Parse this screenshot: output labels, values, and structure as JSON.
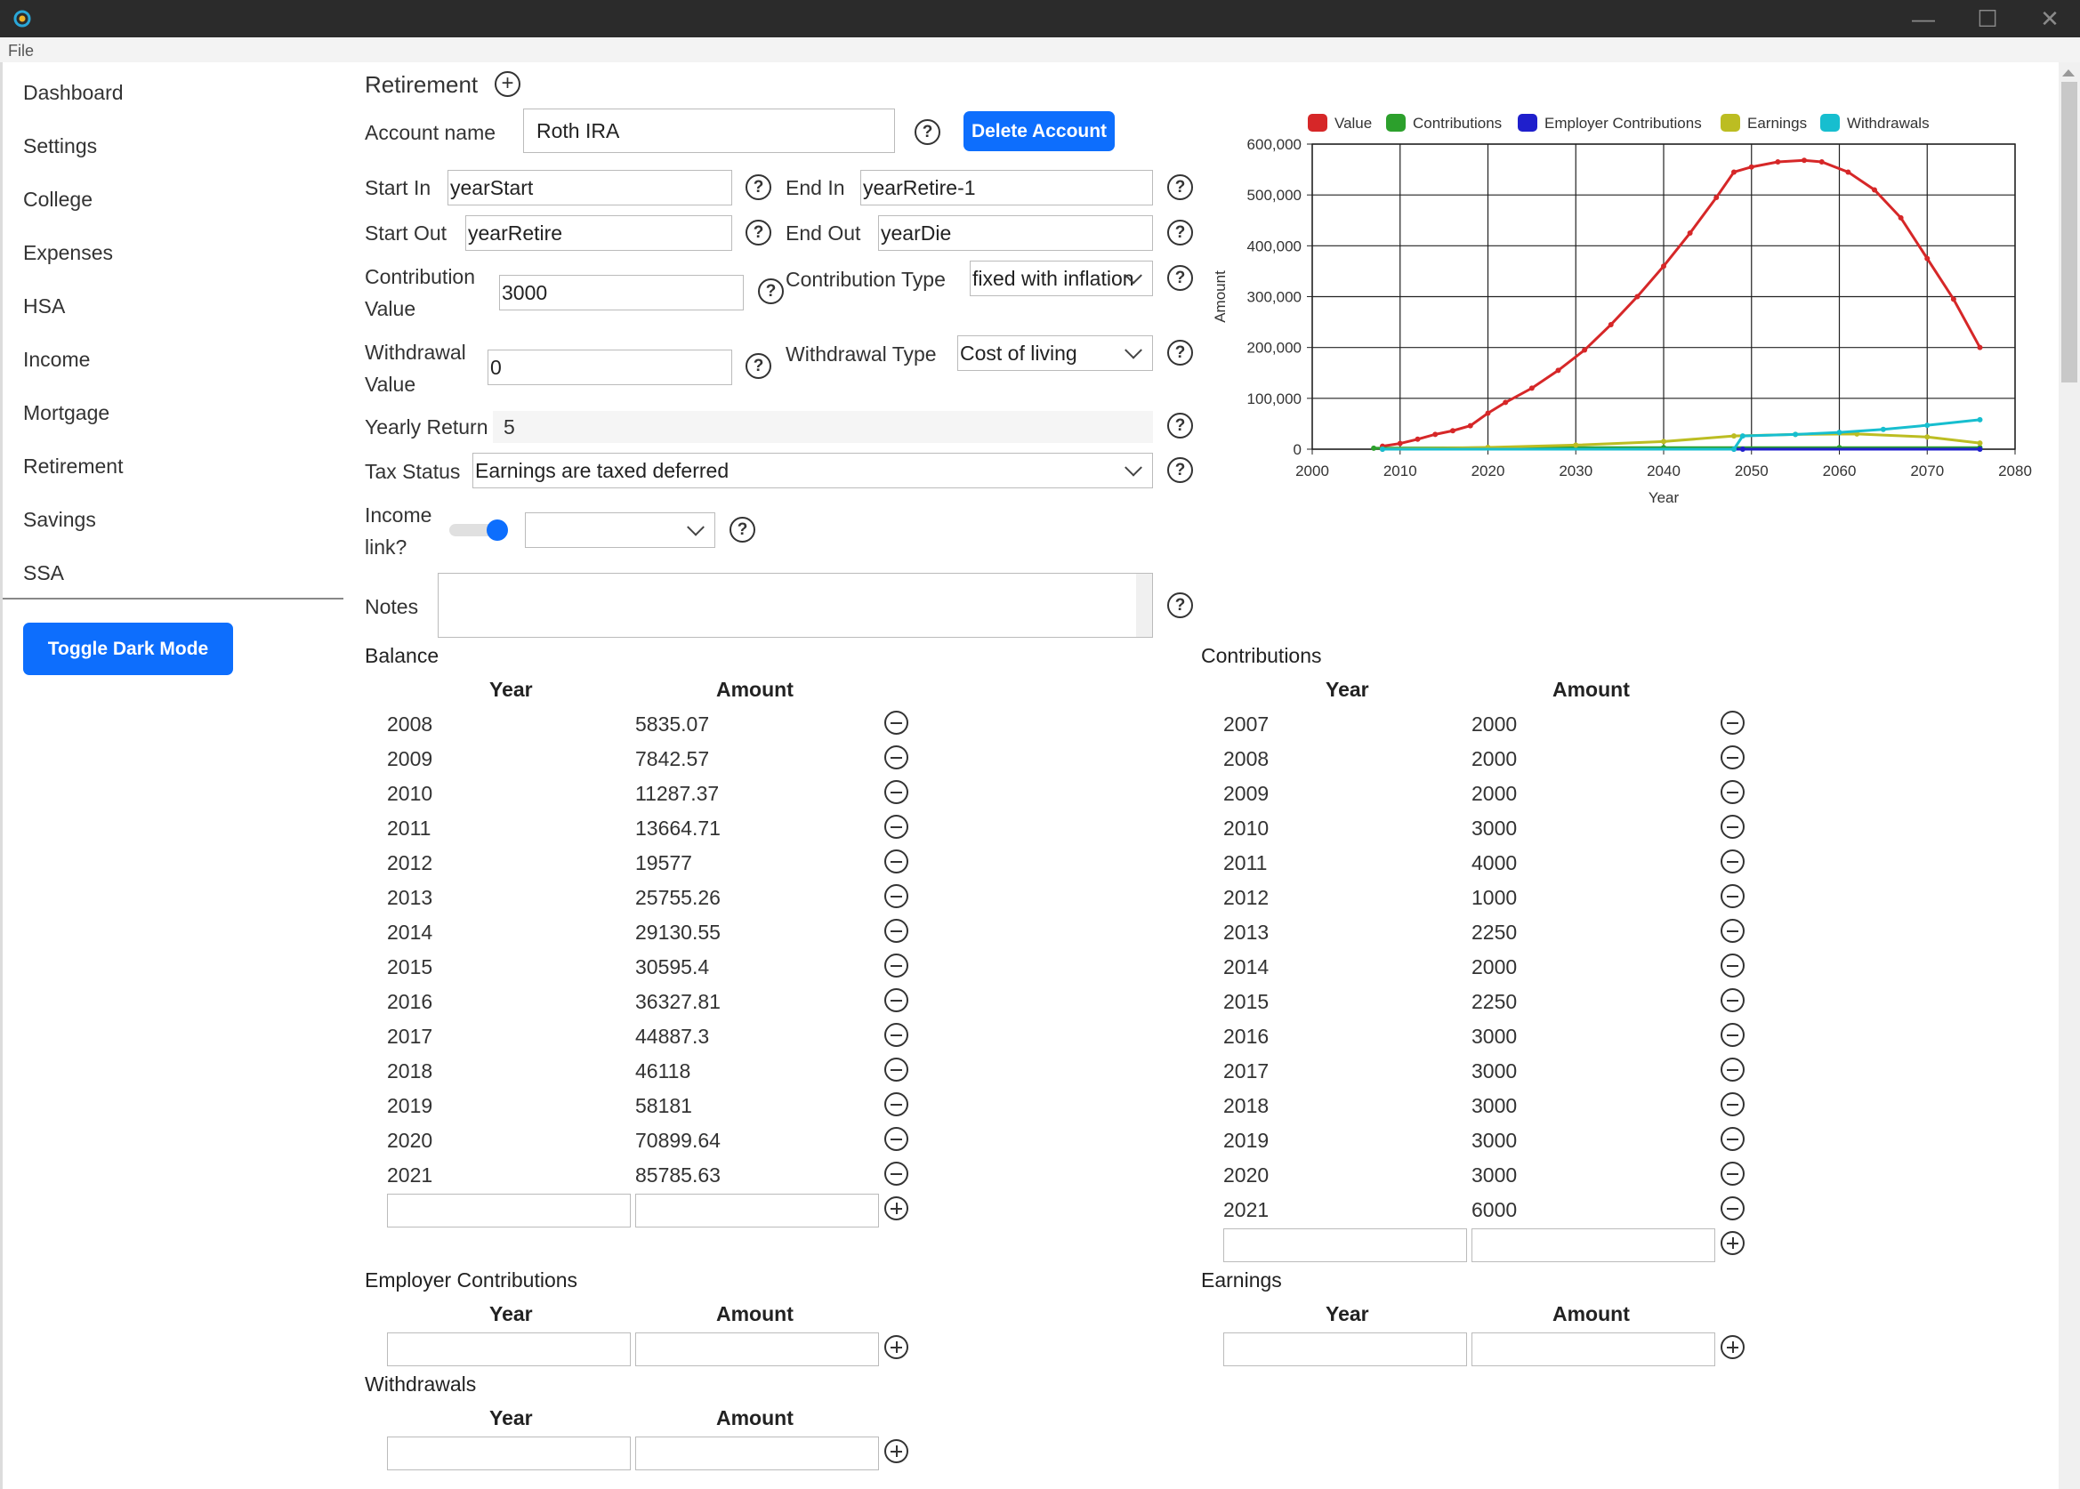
{
  "app": {
    "menu": {
      "file": "File"
    },
    "window_controls": {
      "minimize": "—",
      "maximize": "☐",
      "close": "✕"
    }
  },
  "sidebar": {
    "items": [
      {
        "label": "Dashboard"
      },
      {
        "label": "Settings"
      },
      {
        "label": "College"
      },
      {
        "label": "Expenses"
      },
      {
        "label": "HSA"
      },
      {
        "label": "Income"
      },
      {
        "label": "Mortgage"
      },
      {
        "label": "Retirement"
      },
      {
        "label": "Savings"
      },
      {
        "label": "SSA"
      }
    ],
    "toggle_dark_mode": "Toggle Dark Mode"
  },
  "form": {
    "title": "Retirement",
    "add_icon": "⊕",
    "account_name": {
      "label": "Account name",
      "value": "Roth IRA"
    },
    "delete_button": "Delete Account",
    "start_in": {
      "label": "Start In",
      "value": "yearStart"
    },
    "end_in": {
      "label": "End In",
      "value": "yearRetire-1"
    },
    "start_out": {
      "label": "Start Out",
      "value": "yearRetire"
    },
    "end_out": {
      "label": "End Out",
      "value": "yearDie"
    },
    "contribution_value": {
      "label_line1": "Contribution",
      "label_line2": "Value",
      "value": "3000"
    },
    "contribution_type": {
      "label": "Contribution Type",
      "value": "fixed with inflation"
    },
    "withdrawal_value": {
      "label_line1": "Withdrawal",
      "label_line2": "Value",
      "value": "0"
    },
    "withdrawal_type": {
      "label": "Withdrawal Type",
      "value": "Cost of living"
    },
    "yearly_return": {
      "label": "Yearly Return",
      "value": "5"
    },
    "tax_status": {
      "label": "Tax Status",
      "value": "Earnings are taxed deferred"
    },
    "income_link": {
      "label_line1": "Income",
      "label_line2": "link?",
      "value": "",
      "toggle_on": true
    },
    "notes": {
      "label": "Notes",
      "value": ""
    },
    "help_icon": "?"
  },
  "tables": {
    "col_year": "Year",
    "col_amount": "Amount",
    "balance": {
      "title": "Balance",
      "rows": [
        [
          "2008",
          "5835.07"
        ],
        [
          "2009",
          "7842.57"
        ],
        [
          "2010",
          "11287.37"
        ],
        [
          "2011",
          "13664.71"
        ],
        [
          "2012",
          "19577"
        ],
        [
          "2013",
          "25755.26"
        ],
        [
          "2014",
          "29130.55"
        ],
        [
          "2015",
          "30595.4"
        ],
        [
          "2016",
          "36327.81"
        ],
        [
          "2017",
          "44887.3"
        ],
        [
          "2018",
          "46118"
        ],
        [
          "2019",
          "58181"
        ],
        [
          "2020",
          "70899.64"
        ],
        [
          "2021",
          "85785.63"
        ]
      ]
    },
    "contributions": {
      "title": "Contributions",
      "rows": [
        [
          "2007",
          "2000"
        ],
        [
          "2008",
          "2000"
        ],
        [
          "2009",
          "2000"
        ],
        [
          "2010",
          "3000"
        ],
        [
          "2011",
          "4000"
        ],
        [
          "2012",
          "1000"
        ],
        [
          "2013",
          "2250"
        ],
        [
          "2014",
          "2000"
        ],
        [
          "2015",
          "2250"
        ],
        [
          "2016",
          "3000"
        ],
        [
          "2017",
          "3000"
        ],
        [
          "2018",
          "3000"
        ],
        [
          "2019",
          "3000"
        ],
        [
          "2020",
          "3000"
        ],
        [
          "2021",
          "6000"
        ]
      ]
    },
    "employer_contributions": {
      "title": "Employer Contributions",
      "rows": []
    },
    "earnings": {
      "title": "Earnings",
      "rows": []
    },
    "withdrawals": {
      "title": "Withdrawals",
      "rows": []
    }
  },
  "chart_data": {
    "type": "line",
    "xlabel": "Year",
    "ylabel": "Amount",
    "xlim": [
      2000,
      2080
    ],
    "ylim": [
      0,
      600000
    ],
    "xticks": [
      2000,
      2010,
      2020,
      2030,
      2040,
      2050,
      2060,
      2070,
      2080
    ],
    "yticks": [
      0,
      100000,
      200000,
      300000,
      400000,
      500000,
      600000
    ],
    "ytick_labels": [
      "0",
      "100,000",
      "200,000",
      "300,000",
      "400,000",
      "500,000",
      "600,000"
    ],
    "grid": true,
    "legend_position": "top",
    "series": [
      {
        "name": "Value",
        "color": "#d62728",
        "x": [
          2008,
          2010,
          2012,
          2014,
          2016,
          2018,
          2020,
          2022,
          2025,
          2028,
          2031,
          2034,
          2037,
          2040,
          2043,
          2046,
          2048,
          2050,
          2053,
          2056,
          2058,
          2061,
          2064,
          2067,
          2070,
          2073,
          2076
        ],
        "values": [
          5835,
          11287,
          19577,
          29131,
          36328,
          46118,
          70900,
          92000,
          120000,
          155000,
          195000,
          245000,
          300000,
          360000,
          425000,
          495000,
          545000,
          555000,
          565000,
          568000,
          565000,
          545000,
          510000,
          455000,
          375000,
          295000,
          200000
        ]
      },
      {
        "name": "Contributions",
        "color": "#2ca02c",
        "x": [
          2007,
          2020,
          2040,
          2060,
          2076
        ],
        "values": [
          2000,
          3000,
          3000,
          3000,
          3000
        ]
      },
      {
        "name": "Employer Contributions",
        "color": "#1f1fcc",
        "x": [
          2008,
          2048,
          2049,
          2076
        ],
        "values": [
          0,
          0,
          0,
          0
        ]
      },
      {
        "name": "Earnings",
        "color": "#bcbd22",
        "x": [
          2008,
          2020,
          2030,
          2040,
          2048,
          2055,
          2062,
          2070,
          2076
        ],
        "values": [
          300,
          3500,
          8000,
          15000,
          26000,
          29000,
          30000,
          24000,
          12000
        ]
      },
      {
        "name": "Withdrawals",
        "color": "#17becf",
        "x": [
          2008,
          2048,
          2049,
          2055,
          2060,
          2065,
          2070,
          2076
        ],
        "values": [
          0,
          0,
          26000,
          29000,
          33000,
          39000,
          47000,
          58000
        ]
      }
    ]
  }
}
